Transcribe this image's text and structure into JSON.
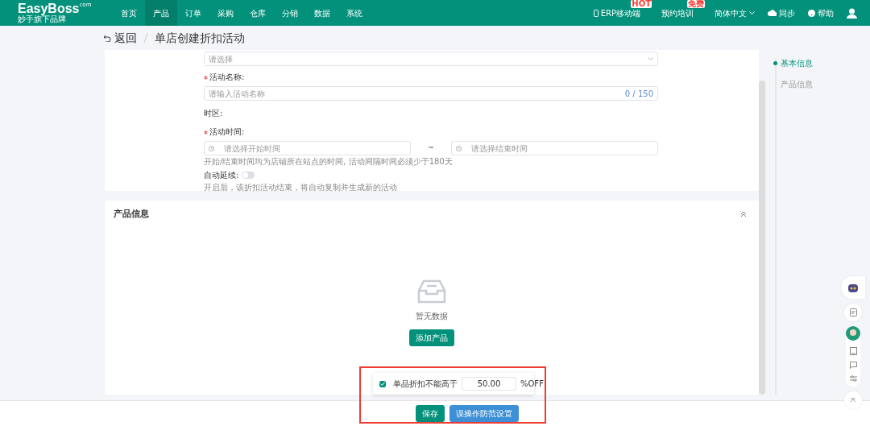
{
  "header": {
    "logo": "EasyBoss",
    "logo_suffix": "com",
    "logo_tagline": "妙手旗下品牌",
    "nav": [
      {
        "label": "首页",
        "selected": false
      },
      {
        "label": "产品",
        "selected": true
      },
      {
        "label": "订单",
        "selected": false
      },
      {
        "label": "采购",
        "selected": false
      },
      {
        "label": "仓库",
        "selected": false
      },
      {
        "label": "分销",
        "selected": false
      },
      {
        "label": "数据",
        "selected": false
      },
      {
        "label": "系统",
        "selected": false
      }
    ],
    "tools": [
      {
        "kind": "mobile",
        "label": "ERP移动端",
        "badge": "HOT"
      },
      {
        "kind": "training",
        "label": "预约培训",
        "badge": "免费"
      },
      {
        "kind": "language",
        "label": "简体中文"
      },
      {
        "kind": "sync",
        "label": "同步"
      },
      {
        "kind": "help",
        "label": "帮助"
      }
    ]
  },
  "breadcrumb": {
    "back": "返回",
    "title": "单店创建折扣活动"
  },
  "basic_form": {
    "select": {
      "placeholder": "请选择"
    },
    "name": {
      "label": "活动名称:",
      "required": true,
      "placeholder": "请输入活动名称",
      "counter": "0 / 150"
    },
    "timezone": {
      "label": "时区:"
    },
    "time": {
      "label": "活动时间:",
      "required": true,
      "start_placeholder": "请选择开始时间",
      "separator": "~",
      "end_placeholder": "请选择结束时间",
      "hint": "开始/结束时间均为店铺所在站点的时间, 活动间隔时间必须少于180天"
    },
    "auto_renew": {
      "label": "自动延续:",
      "on": false,
      "hint": "开启后，该折扣活动结束，将自动复制并生成新的活动"
    }
  },
  "product_section": {
    "title": "产品信息",
    "expanded": true,
    "empty_text": "暂无数据",
    "add_button": "添加产品"
  },
  "anchors": [
    {
      "label": "基本信息",
      "selected": true
    },
    {
      "label": "产品信息",
      "selected": false
    }
  ],
  "popover": {
    "checked": true,
    "label": "单品折扣不能高于",
    "value": "50.00",
    "unit": "%OFF"
  },
  "footer_buttons": [
    {
      "kind": "primary",
      "label": "保存"
    },
    {
      "kind": "info",
      "label": "误操作防范设置"
    }
  ]
}
